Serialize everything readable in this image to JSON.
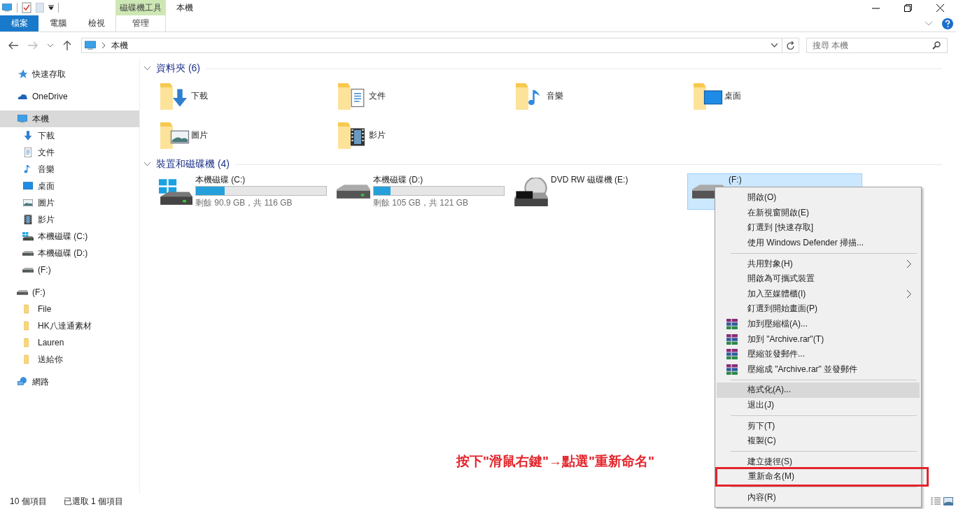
{
  "ribbon": {
    "contextual_group": "磁碟機工具",
    "window_title": "本機",
    "tabs": [
      {
        "label": "檔案",
        "kind": "file",
        "selected": false
      },
      {
        "label": "電腦",
        "kind": "normal",
        "selected": false
      },
      {
        "label": "檢視",
        "kind": "normal",
        "selected": false
      },
      {
        "label": "管理",
        "kind": "contextual",
        "selected": false
      }
    ]
  },
  "address_bar": {
    "path": "本機"
  },
  "search": {
    "placeholder": "搜尋 本機"
  },
  "sidebar": {
    "items": [
      {
        "label": "快速存取",
        "kind": "star",
        "selected": false
      },
      {
        "label": "OneDrive",
        "kind": "cloud",
        "selected": false
      },
      {
        "label": "本機",
        "kind": "pc",
        "selected": true,
        "children": [
          {
            "label": "下載",
            "kind": "download",
            "selected": false
          },
          {
            "label": "文件",
            "kind": "document",
            "selected": false
          },
          {
            "label": "音樂",
            "kind": "music",
            "selected": false
          },
          {
            "label": "桌面",
            "kind": "desktop",
            "selected": false
          },
          {
            "label": "圖片",
            "kind": "pictures",
            "selected": false
          },
          {
            "label": "影片",
            "kind": "videos",
            "selected": false
          },
          {
            "label": "本機磁碟 (C:)",
            "kind": "drive-win",
            "selected": false
          },
          {
            "label": "本機磁碟 (D:)",
            "kind": "drive",
            "selected": false
          },
          {
            "label": "(F:)",
            "kind": "drive",
            "selected": false
          }
        ]
      },
      {
        "label": "(F:)",
        "kind": "drive",
        "selected": false,
        "children": [
          {
            "label": "File",
            "kind": "folder",
            "selected": false
          },
          {
            "label": "HK八達通素材",
            "kind": "folder",
            "selected": false
          },
          {
            "label": "Lauren",
            "kind": "folder",
            "selected": false
          },
          {
            "label": "送給你",
            "kind": "folder",
            "selected": false
          }
        ]
      },
      {
        "label": "網路",
        "kind": "network",
        "selected": false
      }
    ]
  },
  "folders": {
    "title": "資料夾 (6)",
    "items": [
      {
        "name": "下載",
        "kind": "download"
      },
      {
        "name": "文件",
        "kind": "document"
      },
      {
        "name": "音樂",
        "kind": "music"
      },
      {
        "name": "桌面",
        "kind": "desktop"
      },
      {
        "name": "圖片",
        "kind": "pictures"
      },
      {
        "name": "影片",
        "kind": "videos"
      }
    ]
  },
  "devices": {
    "title": "裝置和磁碟機 (4)",
    "items": [
      {
        "name": "本機磁碟 (C:)",
        "kind": "drive-win",
        "level": 0.22,
        "free": "剩餘 90.9 GB，共 116 GB",
        "selected": false
      },
      {
        "name": "本機磁碟 (D:)",
        "kind": "drive",
        "level": 0.13,
        "free": "剩餘 105 GB，共 121 GB",
        "selected": false
      },
      {
        "name": "DVD RW 磁碟機 (E:)",
        "kind": "dvd",
        "selected": false
      },
      {
        "name": "(F:)",
        "kind": "drive",
        "selected": true
      }
    ]
  },
  "context_menu": {
    "items": [
      {
        "kind": "item",
        "label": "開啟(O)",
        "selected": false
      },
      {
        "kind": "item",
        "label": "在新視窗開啟(E)",
        "selected": false
      },
      {
        "kind": "item",
        "label": "釘選到 [快速存取]",
        "selected": false
      },
      {
        "kind": "item",
        "label": "使用 Windows Defender 掃描...",
        "selected": false
      },
      {
        "kind": "separator"
      },
      {
        "kind": "item",
        "label": "共用對象(H)",
        "submenu": true,
        "selected": false
      },
      {
        "kind": "item",
        "label": "開啟為可攜式裝置",
        "selected": false
      },
      {
        "kind": "item",
        "label": "加入至媒體櫃(I)",
        "submenu": true,
        "selected": false
      },
      {
        "kind": "item",
        "label": "釘選到開始畫面(P)",
        "selected": false
      },
      {
        "kind": "archiver-item",
        "label": "加到壓縮檔(A)...",
        "selected": false
      },
      {
        "kind": "archiver-item",
        "label": "加到 \"Archive.rar\"(T)",
        "selected": false
      },
      {
        "kind": "archiver-item",
        "label": "壓縮並發郵件...",
        "selected": false
      },
      {
        "kind": "archiver-item",
        "label": "壓縮成 \"Archive.rar\" 並發郵件",
        "selected": false
      },
      {
        "kind": "separator"
      },
      {
        "kind": "item",
        "label": "格式化(A)...",
        "selected": true
      },
      {
        "kind": "item",
        "label": "退出(J)",
        "selected": false
      },
      {
        "kind": "separator"
      },
      {
        "kind": "item",
        "label": "剪下(T)",
        "selected": false
      },
      {
        "kind": "item",
        "label": "複製(C)",
        "selected": false
      },
      {
        "kind": "separator"
      },
      {
        "kind": "item",
        "label": "建立捷徑(S)",
        "selected": false
      },
      {
        "kind": "item",
        "label": "重新命名(M)",
        "annotated": true,
        "selected": false
      },
      {
        "kind": "separator"
      },
      {
        "kind": "item",
        "label": "內容(R)",
        "selected": false
      }
    ]
  },
  "annotation": {
    "text": "按下\"滑鼠右鍵\"→點選\"重新命名\""
  },
  "status_bar": {
    "item_count": "10 個項目",
    "selection": "已選取 1 個項目"
  }
}
